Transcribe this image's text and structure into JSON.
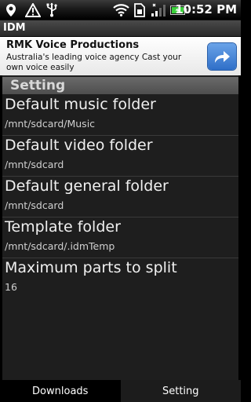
{
  "status_bar": {
    "time": "10:52 PM",
    "icons": [
      "location-pin-icon",
      "warning-icon",
      "usb-icon",
      "wifi-icon",
      "sim-card-icon",
      "signal-icon",
      "battery-charging-icon"
    ],
    "battery_color": "#3bd23b"
  },
  "app": {
    "title": "IDM"
  },
  "ad": {
    "title": "RMK Voice Productions",
    "text": "Australia's leading voice agency Cast your own voice easily",
    "accent_color": "#2f6fc8"
  },
  "settings": {
    "header": "Setting",
    "items": [
      {
        "title": "Default music folder",
        "value": "/mnt/sdcard/Music"
      },
      {
        "title": "Default video folder",
        "value": "/mnt/sdcard"
      },
      {
        "title": "Default general folder",
        "value": "/mnt/sdcard"
      },
      {
        "title": "Template folder",
        "value": "/mnt/sdcard/.idmTemp"
      },
      {
        "title": "Maximum parts to split",
        "value": "16"
      }
    ]
  },
  "tabs": [
    {
      "label": "Downloads",
      "selected": false
    },
    {
      "label": "Setting",
      "selected": true
    }
  ]
}
